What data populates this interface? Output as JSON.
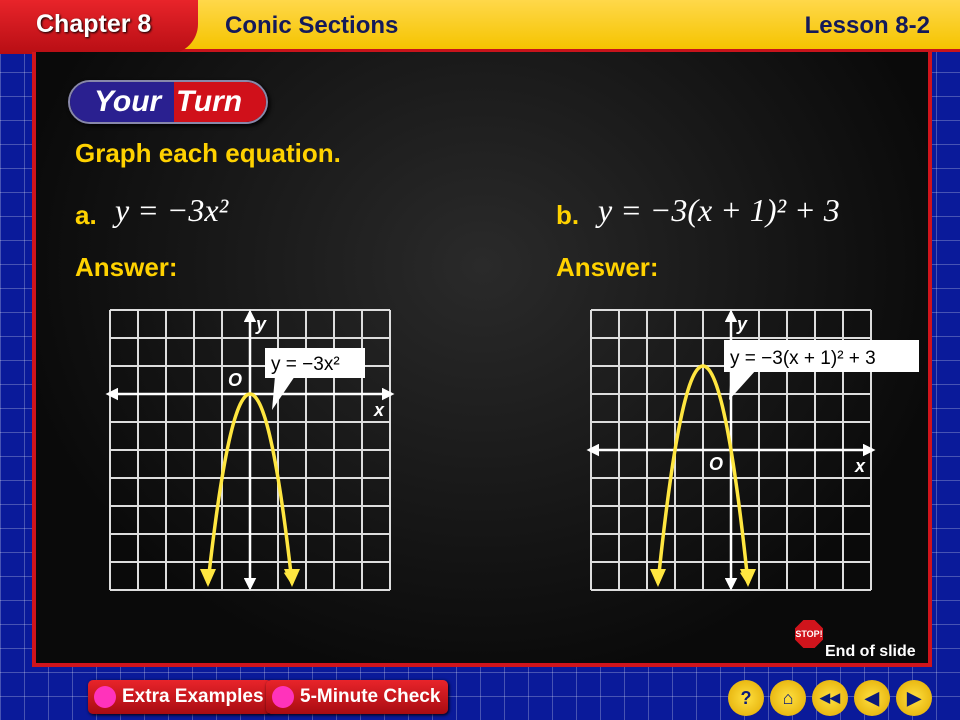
{
  "header": {
    "chapter": "Chapter 8",
    "title": "Conic Sections",
    "lesson": "Lesson 8-2"
  },
  "badge": {
    "your": "Your",
    "turn": "Turn"
  },
  "prompt": "Graph each equation.",
  "parts": [
    {
      "label": "a.",
      "equation": "y = −3x²",
      "answer_label": "Answer:",
      "callout": "y = −3x²"
    },
    {
      "label": "b.",
      "equation": "y = −3(x + 1)² + 3",
      "answer_label": "Answer:",
      "callout": "y = −3(x + 1)² + 3"
    }
  ],
  "axis": {
    "x": "x",
    "y": "y",
    "origin": "O"
  },
  "chart_data": [
    {
      "type": "line",
      "equation": "y = -3x^2",
      "a": -3,
      "h": 0,
      "k": 0,
      "vertex": [
        0,
        0
      ],
      "xlim": [
        -5,
        5
      ],
      "ylim": [
        -7,
        3
      ],
      "grid": true,
      "curve_color": "#ffe640"
    },
    {
      "type": "line",
      "equation": "y = -3(x+1)^2 + 3",
      "a": -3,
      "h": -1,
      "k": 3,
      "vertex": [
        -1,
        3
      ],
      "xlim": [
        -5,
        5
      ],
      "ylim": [
        -5,
        5
      ],
      "grid": true,
      "curve_color": "#ffe640"
    }
  ],
  "footer": {
    "end_of_slide": "End of slide",
    "stop": "STOP!",
    "extra_examples": "Extra Examples",
    "five_minute_check": "5-Minute Check",
    "help": "?",
    "home": "⌂",
    "first": "◀◀",
    "prev": "◀",
    "next": "▶"
  }
}
